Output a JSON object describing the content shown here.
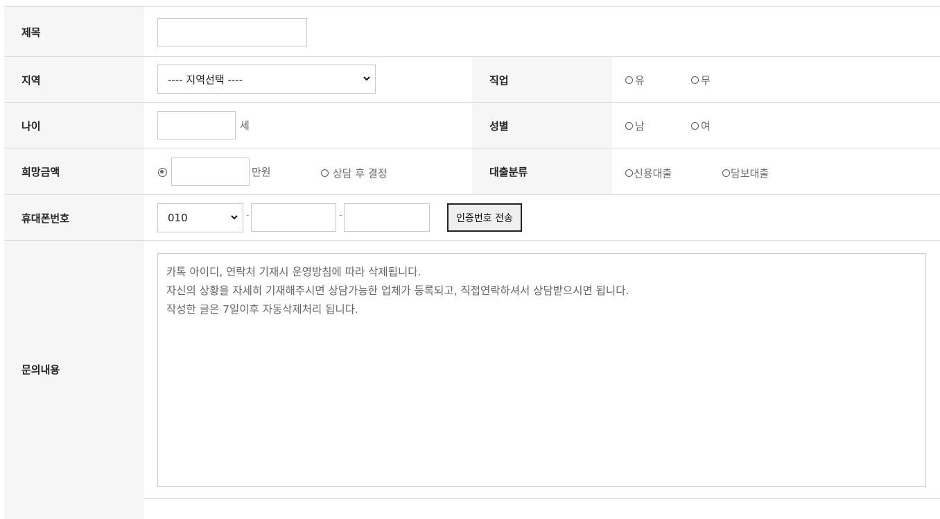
{
  "fields": {
    "title": {
      "label": "제목",
      "value": ""
    },
    "region": {
      "label": "지역",
      "selected": "---- 지역선택 ----"
    },
    "job": {
      "label": "직업",
      "options": [
        "유",
        "무"
      ]
    },
    "age": {
      "label": "나이",
      "value": "",
      "unit": "세"
    },
    "gender": {
      "label": "성별",
      "options": [
        "남",
        "여"
      ]
    },
    "amount": {
      "label": "희망금액",
      "value": "",
      "unit": "만원",
      "alt_option": "상담 후 결정"
    },
    "loan_type": {
      "label": "대출분류",
      "options": [
        "신용대출",
        "담보대출"
      ]
    },
    "phone": {
      "label": "휴대폰번호",
      "prefix": "010",
      "middle": "",
      "last": "",
      "separator": "-",
      "send_button": "인증번호 전송"
    },
    "inquiry": {
      "label": "문의내용",
      "placeholder_lines": [
        "카톡 아이디, 연락처 기재시 운영방침에 따라 삭제됩니다.",
        "자신의 상황을 자세히 기재해주시면  상담가능한 업체가 등록되고, 직접연락하셔서 상담받으시면 됩니다.",
        "작성한 글은 7일이후 자동삭제처리 됩니다."
      ]
    }
  }
}
